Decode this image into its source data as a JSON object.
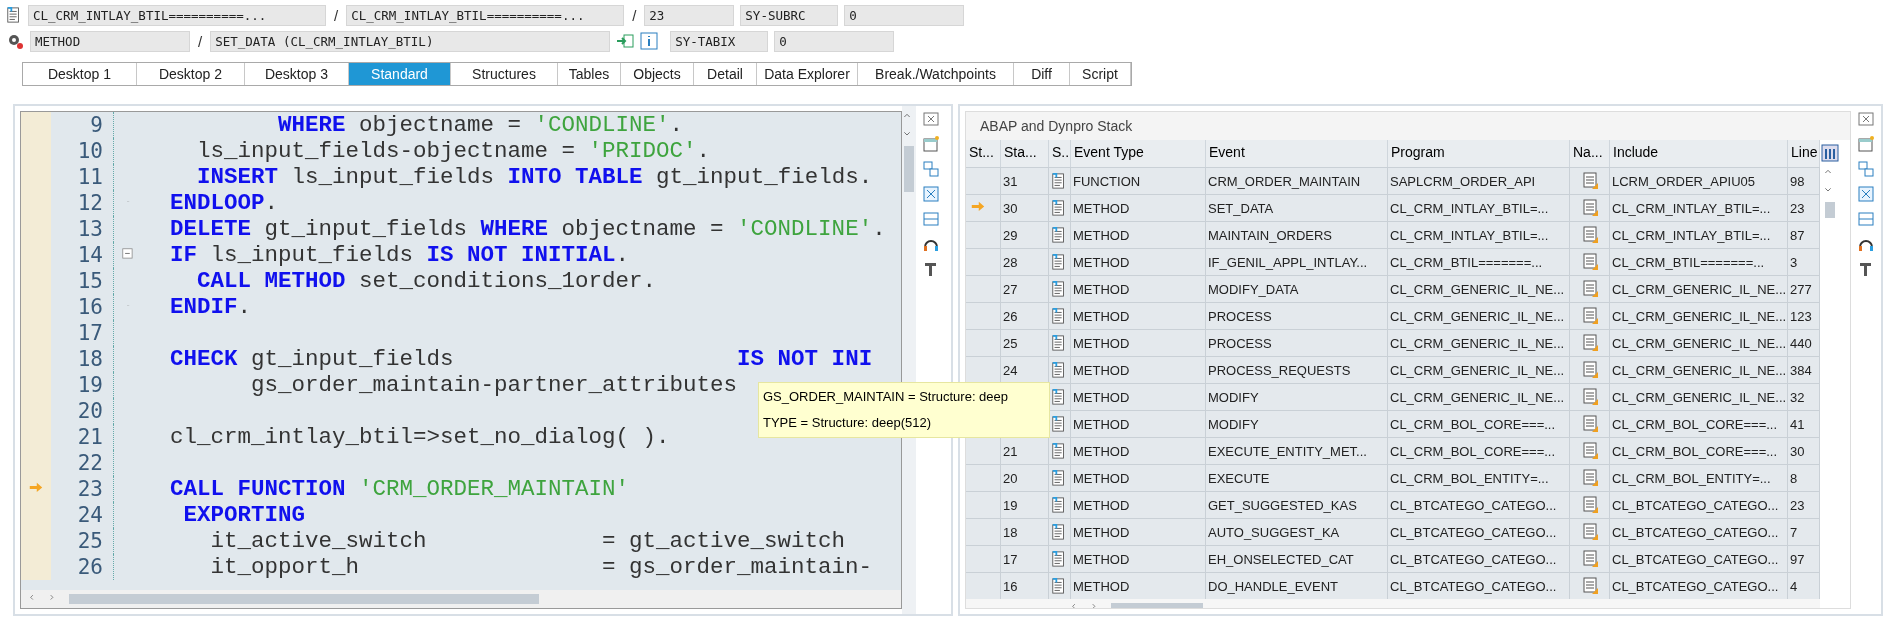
{
  "header": {
    "program": "CL_CRM_INTLAY_BTIL==========...",
    "separator_1": "/",
    "include": "CL_CRM_INTLAY_BTIL==========...",
    "separator_2": "/",
    "line": "23",
    "sys1_label": "SY-SUBRC",
    "sys1_value": "0",
    "event_type": "METHOD",
    "separator_3": "/",
    "event": "SET_DATA (CL_CRM_INTLAY_BTIL)",
    "sys2_label": "SY-TABIX",
    "sys2_value": "0"
  },
  "tabs": [
    {
      "label": "Desktop 1",
      "selected": false
    },
    {
      "label": "Desktop 2",
      "selected": false
    },
    {
      "label": "Desktop 3",
      "selected": false
    },
    {
      "label": "Standard",
      "selected": true
    },
    {
      "label": "Structures",
      "selected": false
    },
    {
      "label": "Tables",
      "selected": false
    },
    {
      "label": "Objects",
      "selected": false
    },
    {
      "label": "Detail",
      "selected": false
    },
    {
      "label": "Data Explorer",
      "selected": false
    },
    {
      "label": "Break./Watchpoints",
      "selected": false
    },
    {
      "label": "Diff",
      "selected": false
    },
    {
      "label": "Script",
      "selected": false
    }
  ],
  "source": {
    "lines": [
      {
        "number": "9",
        "current": false,
        "kind": "plain",
        "segments": [
          {
            "kind": "keyword",
            "text": "        WHERE"
          },
          {
            "kind": "text",
            "text": " objectname = "
          },
          {
            "kind": "string",
            "text": "'CONDLINE'"
          },
          {
            "kind": "text",
            "text": "."
          }
        ]
      },
      {
        "number": "10",
        "current": false,
        "kind": "plain",
        "segments": [
          {
            "kind": "text",
            "text": "  ls_input_fields-objectname = "
          },
          {
            "kind": "string",
            "text": "'PRIDOC'"
          },
          {
            "kind": "text",
            "text": "."
          }
        ]
      },
      {
        "number": "11",
        "current": false,
        "kind": "plain",
        "segments": [
          {
            "kind": "keyword",
            "text": "  INSERT"
          },
          {
            "kind": "text",
            "text": " ls_input_fields "
          },
          {
            "kind": "keyword",
            "text": "INTO TABLE"
          },
          {
            "kind": "text",
            "text": " gt_input_fields."
          }
        ]
      },
      {
        "number": "12",
        "current": false,
        "kind": "block-end",
        "segments": [
          {
            "kind": "keyword",
            "text": "ENDLOOP"
          },
          {
            "kind": "text",
            "text": "."
          }
        ]
      },
      {
        "number": "13",
        "current": false,
        "kind": "plain",
        "segments": [
          {
            "kind": "keyword",
            "text": "DELETE"
          },
          {
            "kind": "text",
            "text": " gt_input_fields "
          },
          {
            "kind": "keyword",
            "text": "WHERE"
          },
          {
            "kind": "text",
            "text": " objectname = "
          },
          {
            "kind": "string",
            "text": "'CONDLINE'"
          },
          {
            "kind": "text",
            "text": "."
          }
        ]
      },
      {
        "number": "14",
        "current": false,
        "kind": "block-start",
        "segments": [
          {
            "kind": "keyword",
            "text": "IF"
          },
          {
            "kind": "text",
            "text": " ls_input_fields "
          },
          {
            "kind": "keyword",
            "text": "IS NOT INITIAL"
          },
          {
            "kind": "text",
            "text": "."
          }
        ]
      },
      {
        "number": "15",
        "current": false,
        "kind": "plain",
        "segments": [
          {
            "kind": "keyword",
            "text": "  CALL METHOD"
          },
          {
            "kind": "text",
            "text": " set_conditions_1order."
          }
        ]
      },
      {
        "number": "16",
        "current": false,
        "kind": "block-end",
        "segments": [
          {
            "kind": "keyword",
            "text": "ENDIF"
          },
          {
            "kind": "text",
            "text": "."
          }
        ]
      },
      {
        "number": "17",
        "current": false,
        "kind": "plain"
      },
      {
        "number": "18",
        "current": false,
        "kind": "plain",
        "segments": [
          {
            "kind": "keyword",
            "text": "CHECK"
          },
          {
            "kind": "text",
            "text": " gt_input_fields                     "
          },
          {
            "kind": "keyword",
            "text": "IS NOT INI"
          }
        ]
      },
      {
        "number": "19",
        "current": false,
        "kind": "plain",
        "segments": [
          {
            "kind": "text",
            "text": "      gs_order_maintain-partner_attributes"
          }
        ]
      },
      {
        "number": "20",
        "current": false,
        "kind": "plain"
      },
      {
        "number": "21",
        "current": false,
        "kind": "plain",
        "segments": [
          {
            "kind": "text",
            "text": "cl_crm_intlay_btil=>set_no_dialog( )."
          }
        ]
      },
      {
        "number": "22",
        "current": false,
        "kind": "plain"
      },
      {
        "number": "23",
        "current": true,
        "kind": "plain",
        "segments": [
          {
            "kind": "keyword",
            "text": "CALL FUNCTION"
          },
          {
            "kind": "string",
            "text": " 'CRM_ORDER_MAINTAIN'"
          }
        ]
      },
      {
        "number": "24",
        "current": false,
        "kind": "plain",
        "segments": [
          {
            "kind": "keyword",
            "text": " EXPORTING"
          }
        ]
      },
      {
        "number": "25",
        "current": false,
        "kind": "plain",
        "segments": [
          {
            "kind": "text",
            "text": "   it_active_switch             = gt_active_switch"
          }
        ]
      },
      {
        "number": "26",
        "current": false,
        "kind": "plain",
        "segments": [
          {
            "kind": "text",
            "text": "   it_opport_h                  = gs_order_maintain-"
          }
        ]
      }
    ]
  },
  "tooltip": [
    "GS_ORDER_MAINTAIN = Structure: deep",
    "TYPE  = Structure: deep(512)"
  ],
  "stack": {
    "title": "ABAP and Dynpro Stack",
    "columns": [
      "St...",
      "Sta...",
      "S..",
      "Event Type",
      "Event",
      "Program",
      "Na...",
      "Include",
      "Line"
    ],
    "rows": [
      {
        "current": false,
        "level": "31",
        "type": "FUNCTION",
        "event": "CRM_ORDER_MAINTAIN",
        "program": "SAPLCRM_ORDER_API",
        "include": "LCRM_ORDER_APIU05",
        "line": "98"
      },
      {
        "current": true,
        "level": "30",
        "type": "METHOD",
        "event": "SET_DATA",
        "program": "CL_CRM_INTLAY_BTIL=...",
        "include": "CL_CRM_INTLAY_BTIL=...",
        "line": "23"
      },
      {
        "current": false,
        "level": "29",
        "type": "METHOD",
        "event": "MAINTAIN_ORDERS",
        "program": "CL_CRM_INTLAY_BTIL=...",
        "include": "CL_CRM_INTLAY_BTIL=...",
        "line": "87"
      },
      {
        "current": false,
        "level": "28",
        "type": "METHOD",
        "event": "IF_GENIL_APPL_INTLAY...",
        "program": "CL_CRM_BTIL=======...",
        "include": "CL_CRM_BTIL=======...",
        "line": "3"
      },
      {
        "current": false,
        "level": "27",
        "type": "METHOD",
        "event": "MODIFY_DATA",
        "program": "CL_CRM_GENERIC_IL_NE...",
        "include": "CL_CRM_GENERIC_IL_NE...",
        "line": "277"
      },
      {
        "current": false,
        "level": "26",
        "type": "METHOD",
        "event": "PROCESS",
        "program": "CL_CRM_GENERIC_IL_NE...",
        "include": "CL_CRM_GENERIC_IL_NE...",
        "line": "123"
      },
      {
        "current": false,
        "level": "25",
        "type": "METHOD",
        "event": "PROCESS",
        "program": "CL_CRM_GENERIC_IL_NE...",
        "include": "CL_CRM_GENERIC_IL_NE...",
        "line": "440"
      },
      {
        "current": false,
        "level": "24",
        "type": "METHOD",
        "event": "PROCESS_REQUESTS",
        "program": "CL_CRM_GENERIC_IL_NE...",
        "include": "CL_CRM_GENERIC_IL_NE...",
        "line": "384"
      },
      {
        "type": "METHOD",
        "event": "MODIFY",
        "program": "CL_CRM_GENERIC_IL_NE...",
        "include": "CL_CRM_GENERIC_IL_NE...",
        "line": "32"
      },
      {
        "type": "METHOD",
        "event": "MODIFY",
        "program": "CL_CRM_BOL_CORE===...",
        "include": "CL_CRM_BOL_CORE===...",
        "line": "41"
      },
      {
        "current": false,
        "level": "21",
        "type": "METHOD",
        "event": "EXECUTE_ENTITY_MET...",
        "program": "CL_CRM_BOL_CORE===...",
        "include": "CL_CRM_BOL_CORE===...",
        "line": "30"
      },
      {
        "current": false,
        "level": "20",
        "type": "METHOD",
        "event": "EXECUTE",
        "program": "CL_CRM_BOL_ENTITY=...",
        "include": "CL_CRM_BOL_ENTITY=...",
        "line": "8"
      },
      {
        "current": false,
        "level": "19",
        "type": "METHOD",
        "event": "GET_SUGGESTED_KAS",
        "program": "CL_BTCATEGO_CATEGO...",
        "include": "CL_BTCATEGO_CATEGO...",
        "line": "23"
      },
      {
        "current": false,
        "level": "18",
        "type": "METHOD",
        "event": "AUTO_SUGGEST_KA",
        "program": "CL_BTCATEGO_CATEGO...",
        "include": "CL_BTCATEGO_CATEGO...",
        "line": "7"
      },
      {
        "current": false,
        "level": "17",
        "type": "METHOD",
        "event": "EH_ONSELECTED_CAT",
        "program": "CL_BTCATEGO_CATEGO...",
        "include": "CL_BTCATEGO_CATEGO...",
        "line": "97"
      },
      {
        "current": false,
        "level": "16",
        "type": "METHOD",
        "event": "DO_HANDLE_EVENT",
        "program": "CL_BTCATEGO_CATEGO...",
        "include": "CL_BTCATEGO_CATEGO...",
        "line": "4"
      }
    ]
  }
}
